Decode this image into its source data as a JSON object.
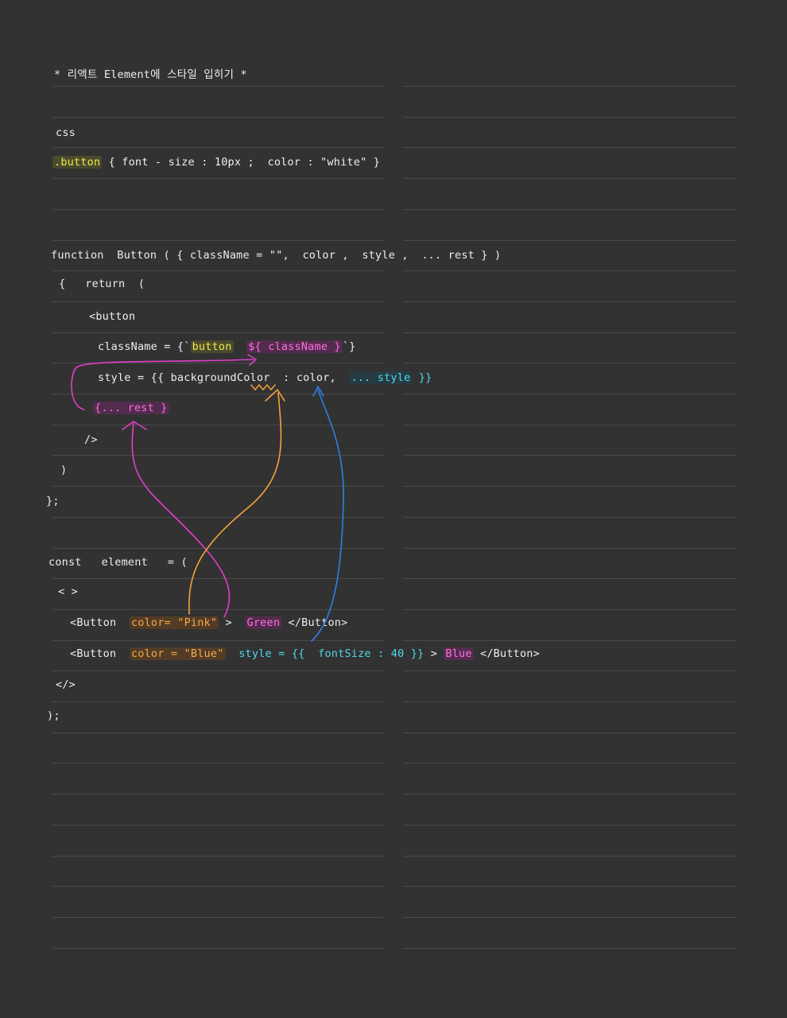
{
  "note": {
    "title": "* 리액트 Element에 스타일 입히기 *",
    "css_heading": "css",
    "css_rule": {
      "selector": ".button",
      "body": " { font - size : 10px ;  color : \"white\" }"
    },
    "function_block": {
      "signature": "function  Button ( { className = \"\",  color ,  style ,  ... rest } )",
      "open_return": "{   return  (",
      "tag_open": "<button",
      "classname_prefix": "className = {`",
      "classname_button": "button",
      "classname_space": "  ",
      "classname_var": "${ className }",
      "classname_suffix": "`}",
      "style_prefix": "style = {{ backgroundColor  : ",
      "style_color": "color",
      "style_comma": ",  ",
      "style_spread": "... style",
      "style_suffix": " }}",
      "rest_spread": "{... rest }",
      "tag_close": "/>",
      "close_paren": ")",
      "close_brace": "};"
    },
    "element_block": {
      "declaration": "const   element   = (",
      "fragment_open": "< >",
      "button1": {
        "open": "<Button  ",
        "color_attr": "color= \"Pink\"",
        "gt": " >  ",
        "text": "Green",
        "close": " </Button>"
      },
      "button2": {
        "open": "<Button  ",
        "color_attr": "color = \"Blue\"",
        "spacer": "  ",
        "style_attr": "style = {{  fontSize : 40 }}",
        "gt": " > ",
        "text": "Blue",
        "close": " </Button>"
      },
      "fragment_close": "</>",
      "end": ");"
    }
  },
  "colors": {
    "background": "#323232",
    "rule_line": "#4a4a4a",
    "magenta_arrow": "#e23fc8",
    "orange_arrow": "#f5a23a",
    "blue_arrow": "#2f7fe6"
  }
}
